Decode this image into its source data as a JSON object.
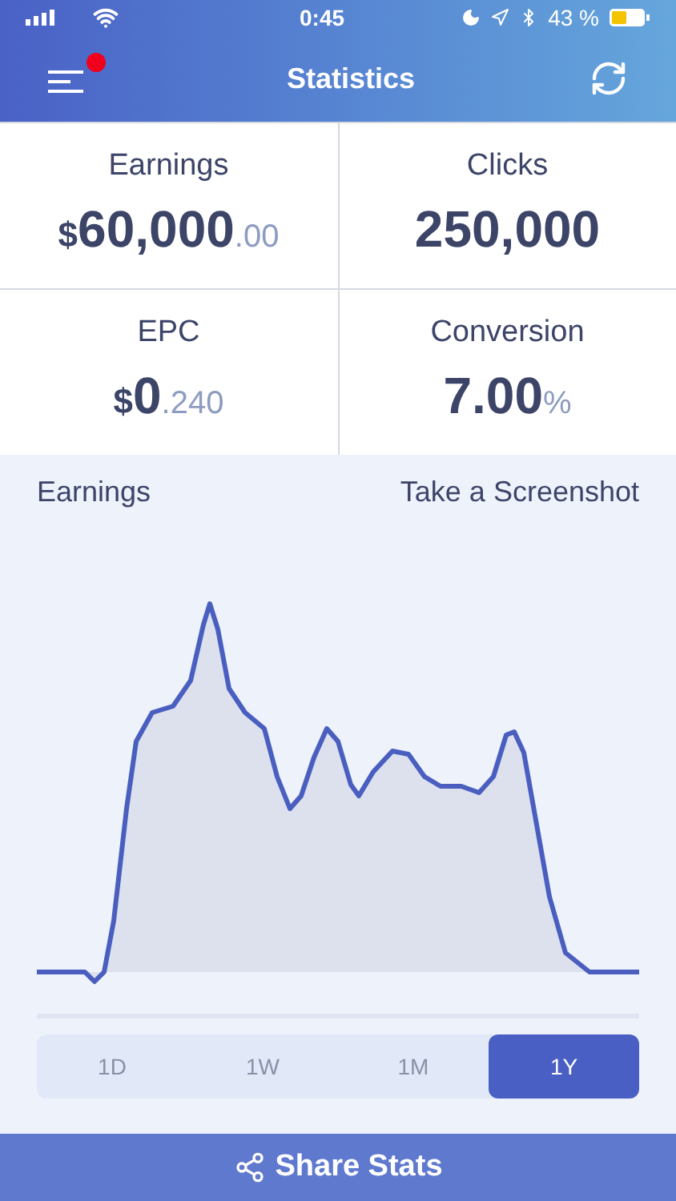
{
  "status_bar": {
    "time": "0:45",
    "battery": "43 %"
  },
  "header": {
    "title": "Statistics",
    "notification": true
  },
  "stats": [
    {
      "label": "Earnings",
      "prefix": "$",
      "value": "60,000",
      "suffix": ".00"
    },
    {
      "label": "Clicks",
      "value": "250,000"
    },
    {
      "label": "EPC",
      "prefix": "$",
      "value": "0",
      "suffix": ".240"
    },
    {
      "label": "Conversion",
      "value": "7.00",
      "suffix": "%"
    }
  ],
  "chart": {
    "title": "Earnings",
    "action": "Take a Screenshot"
  },
  "ranges": [
    {
      "label": "1D",
      "selected": false
    },
    {
      "label": "1W",
      "selected": false
    },
    {
      "label": "1M",
      "selected": false
    },
    {
      "label": "1Y",
      "selected": true
    }
  ],
  "share_button": "Share Stats"
}
